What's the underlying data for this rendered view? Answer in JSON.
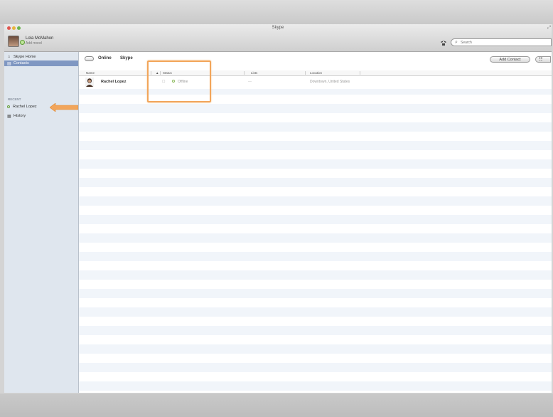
{
  "window": {
    "title": "Skype",
    "expand_glyph": "⤢"
  },
  "profile": {
    "name": "Lola McMahon",
    "mood": "Add mood",
    "status_icon": "online-status-icon"
  },
  "toolbar": {
    "dialpad_icon": "dialpad-icon",
    "search_placeholder": "Search",
    "search_glyph": "⌕"
  },
  "sidebar": {
    "items": [
      {
        "label": "Skype Home",
        "icon": "home-icon",
        "glyph": "⌂"
      },
      {
        "label": "Contacts",
        "icon": "contacts-icon",
        "glyph": "▤"
      }
    ],
    "recent_heading": "RECENT",
    "recent": [
      {
        "label": "Rachel Lopez",
        "icon": "offline-status-icon"
      }
    ],
    "history": {
      "label": "History",
      "icon": "history-icon",
      "glyph": "▦"
    }
  },
  "main": {
    "filters": {
      "online": "Online",
      "skype": "Skype"
    },
    "add_contact": "Add Contact",
    "view_glyph": "☷",
    "columns": {
      "name": "Name",
      "sort": "▲",
      "status": "Status",
      "lists": "Lists",
      "location": "Location"
    },
    "contacts": [
      {
        "name": "Rachel Lopez",
        "status": "Offline",
        "lists": "—",
        "location": "Downtown, United States",
        "cell_glyph": "☐"
      }
    ]
  },
  "annotations": {
    "highlight_color": "#f2a55a",
    "arrow_color": "#f2a55a"
  }
}
